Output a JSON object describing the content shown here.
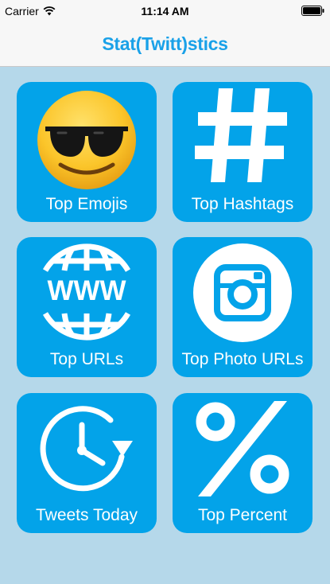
{
  "status_bar": {
    "carrier": "Carrier",
    "time": "11:14 AM"
  },
  "nav": {
    "title": "Stat(Twitt)stics"
  },
  "colors": {
    "tile": "#03a3e9",
    "background": "#b5d8ea",
    "title": "#1aa1e8"
  },
  "tiles": [
    {
      "label": "Top Emojis",
      "icon": "sunglasses-emoji-icon"
    },
    {
      "label": "Top Hashtags",
      "icon": "hashtag-icon"
    },
    {
      "label": "Top URLs",
      "icon": "www-globe-icon"
    },
    {
      "label": "Top Photo URLs",
      "icon": "instagram-camera-icon"
    },
    {
      "label": "Tweets Today",
      "icon": "clock-refresh-icon"
    },
    {
      "label": "Top Percent",
      "icon": "percent-icon"
    }
  ]
}
